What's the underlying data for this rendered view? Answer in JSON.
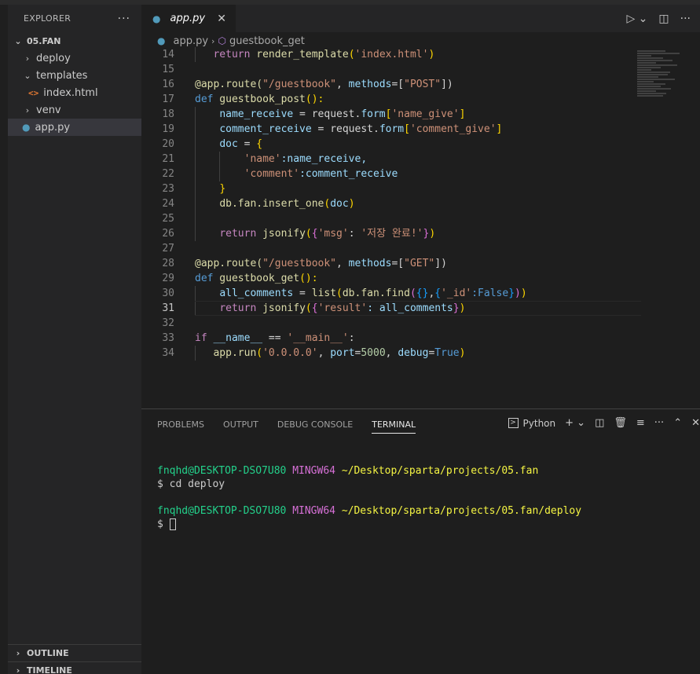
{
  "sidebar": {
    "title": "EXPLORER",
    "more": "···",
    "root": "05.FAN",
    "items": [
      {
        "label": "deploy"
      },
      {
        "label": "templates"
      },
      {
        "label": "index.html"
      },
      {
        "label": "venv"
      },
      {
        "label": "app.py"
      }
    ],
    "outline": "OUTLINE",
    "timeline": "TIMELINE"
  },
  "editor": {
    "tab_label": "app.py",
    "breadcrumb_file": "app.py",
    "breadcrumb_symbol": "guestbook_get",
    "line_numbers": [
      "14",
      "15",
      "16",
      "17",
      "18",
      "19",
      "20",
      "21",
      "22",
      "23",
      "24",
      "25",
      "26",
      "27",
      "28",
      "29",
      "30",
      "31",
      "32",
      "33",
      "34"
    ]
  },
  "code": {
    "l14": [
      "return",
      " render_template",
      "(",
      "'index.html'",
      ")"
    ],
    "l16": [
      "@app.route(",
      "\"/guestbook\"",
      ", ",
      "methods",
      "=[",
      "\"POST\"",
      "])"
    ],
    "l17": [
      "def",
      " guestbook_post",
      "():"
    ],
    "l18": [
      "name_receive",
      " = request.",
      "form",
      "[",
      "'name_give'",
      "]"
    ],
    "l19": [
      "comment_receive",
      " = request.",
      "form",
      "[",
      "'comment_give'",
      "]"
    ],
    "l20": [
      "doc",
      " = ",
      "{"
    ],
    "l21": [
      "'name'",
      ":name_receive,"
    ],
    "l22": [
      "'comment'",
      ":comment_receive"
    ],
    "l23": [
      "}"
    ],
    "l24": [
      "db.fan.insert_one",
      "(",
      "doc",
      ")"
    ],
    "l26": [
      "return",
      " jsonify",
      "(",
      "{",
      "'msg'",
      ": ",
      "'저장 완료!'",
      "}",
      ")"
    ],
    "l28": [
      "@app.route(",
      "\"/guestbook\"",
      ", ",
      "methods",
      "=[",
      "\"GET\"",
      "])"
    ],
    "l29": [
      "def",
      " guestbook_get",
      "():"
    ],
    "l30": [
      "all_comments",
      " = ",
      "list",
      "(",
      "db.fan.find",
      "(",
      "{}",
      ",",
      "{",
      "'_id'",
      ":False",
      "}",
      ")",
      ")"
    ],
    "l31": [
      "return",
      " jsonify",
      "(",
      "{",
      "'result'",
      ": all_comments",
      "}",
      ")"
    ],
    "l33": [
      "if",
      " __name__",
      " == ",
      "'__main__'",
      ":"
    ],
    "l34": [
      "app.run",
      "(",
      "'0.0.0.0'",
      ", ",
      "port",
      "=",
      "5000",
      ", ",
      "debug",
      "=",
      "True",
      ")"
    ]
  },
  "panel": {
    "tabs": [
      "PROBLEMS",
      "OUTPUT",
      "DEBUG CONSOLE",
      "TERMINAL"
    ],
    "terminal_name": "Python",
    "prompt1_user": "fnqhd@DESKTOP-DSO7U80",
    "prompt1_env": "MINGW64",
    "prompt1_path": "~/Desktop/sparta/projects/05.fan",
    "cmd1": "$ cd deploy",
    "prompt2_user": "fnqhd@DESKTOP-DSO7U80",
    "prompt2_env": "MINGW64",
    "prompt2_path": "~/Desktop/sparta/projects/05.fan/deploy",
    "cmd2": "$ "
  }
}
